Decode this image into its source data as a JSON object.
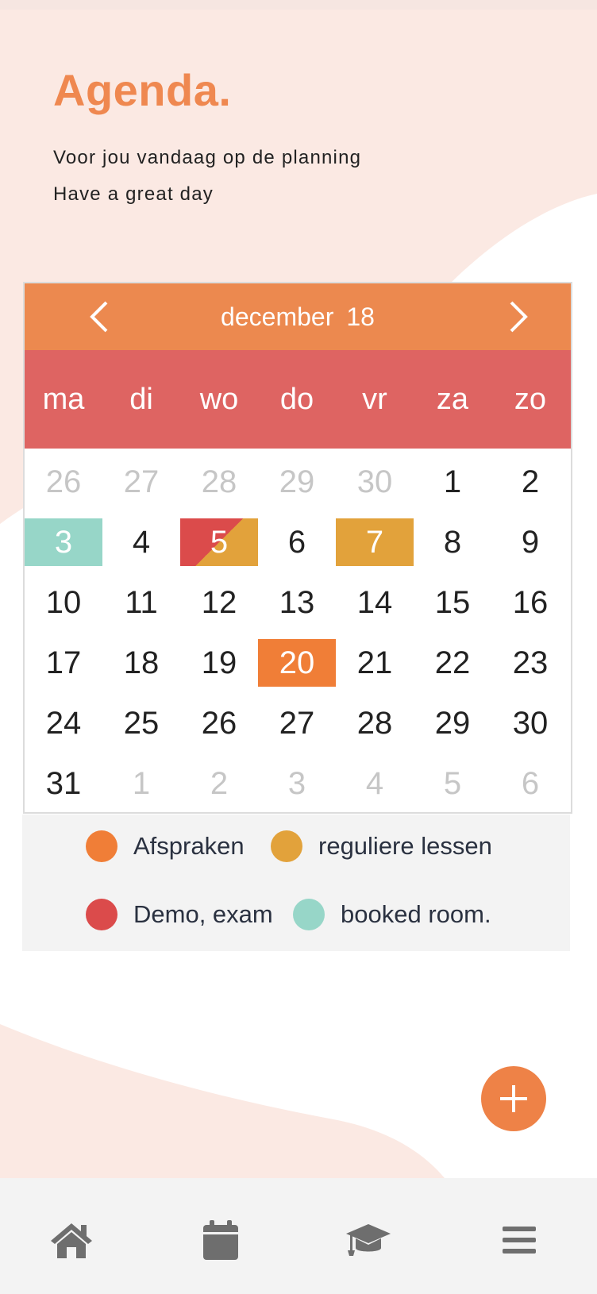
{
  "header": {
    "title": "Agenda.",
    "subtitle_line1": "Voor jou vandaag op de planning",
    "subtitle_line2": "Have a great day"
  },
  "calendar": {
    "month": "december",
    "year_short": "18",
    "prev_icon": "chevron-left-icon",
    "next_icon": "chevron-right-icon",
    "weekdays": [
      "ma",
      "di",
      "wo",
      "do",
      "vr",
      "za",
      "zo"
    ],
    "days": [
      {
        "label": "26",
        "other": true
      },
      {
        "label": "27",
        "other": true
      },
      {
        "label": "28",
        "other": true
      },
      {
        "label": "29",
        "other": true
      },
      {
        "label": "30",
        "other": true
      },
      {
        "label": "1"
      },
      {
        "label": "2"
      },
      {
        "label": "3",
        "mark": "booked"
      },
      {
        "label": "4"
      },
      {
        "label": "5",
        "mark": "demo-regular"
      },
      {
        "label": "6"
      },
      {
        "label": "7",
        "mark": "regular"
      },
      {
        "label": "8"
      },
      {
        "label": "9"
      },
      {
        "label": "10"
      },
      {
        "label": "11"
      },
      {
        "label": "12"
      },
      {
        "label": "13"
      },
      {
        "label": "14"
      },
      {
        "label": "15"
      },
      {
        "label": "16"
      },
      {
        "label": "17"
      },
      {
        "label": "18"
      },
      {
        "label": "19"
      },
      {
        "label": "20",
        "mark": "today"
      },
      {
        "label": "21"
      },
      {
        "label": "22"
      },
      {
        "label": "23"
      },
      {
        "label": "24"
      },
      {
        "label": "25"
      },
      {
        "label": "26"
      },
      {
        "label": "27"
      },
      {
        "label": "28"
      },
      {
        "label": "29"
      },
      {
        "label": "30"
      },
      {
        "label": "31"
      },
      {
        "label": "1",
        "other": true
      },
      {
        "label": "2",
        "other": true
      },
      {
        "label": "3",
        "other": true
      },
      {
        "label": "4",
        "other": true
      },
      {
        "label": "5",
        "other": true
      },
      {
        "label": "6",
        "other": true
      }
    ]
  },
  "legend": [
    {
      "label": "Afspraken",
      "color": "#f07e37"
    },
    {
      "label": "reguliere lessen",
      "color": "#e2a23b"
    },
    {
      "label": "Demo, exam",
      "color": "#db4b4b"
    },
    {
      "label": "booked room.",
      "color": "#97d6c8"
    }
  ],
  "colors": {
    "accent": "#ec894f",
    "weekday_bar": "#de6462",
    "today": "#f07e37",
    "regular": "#e2a23b",
    "demo": "#db4b4b",
    "booked": "#97d6c8"
  },
  "fab": {
    "icon": "plus-icon"
  },
  "bottom_nav": [
    {
      "icon": "home-icon"
    },
    {
      "icon": "calendar-icon"
    },
    {
      "icon": "graduation-cap-icon"
    },
    {
      "icon": "menu-icon"
    }
  ]
}
